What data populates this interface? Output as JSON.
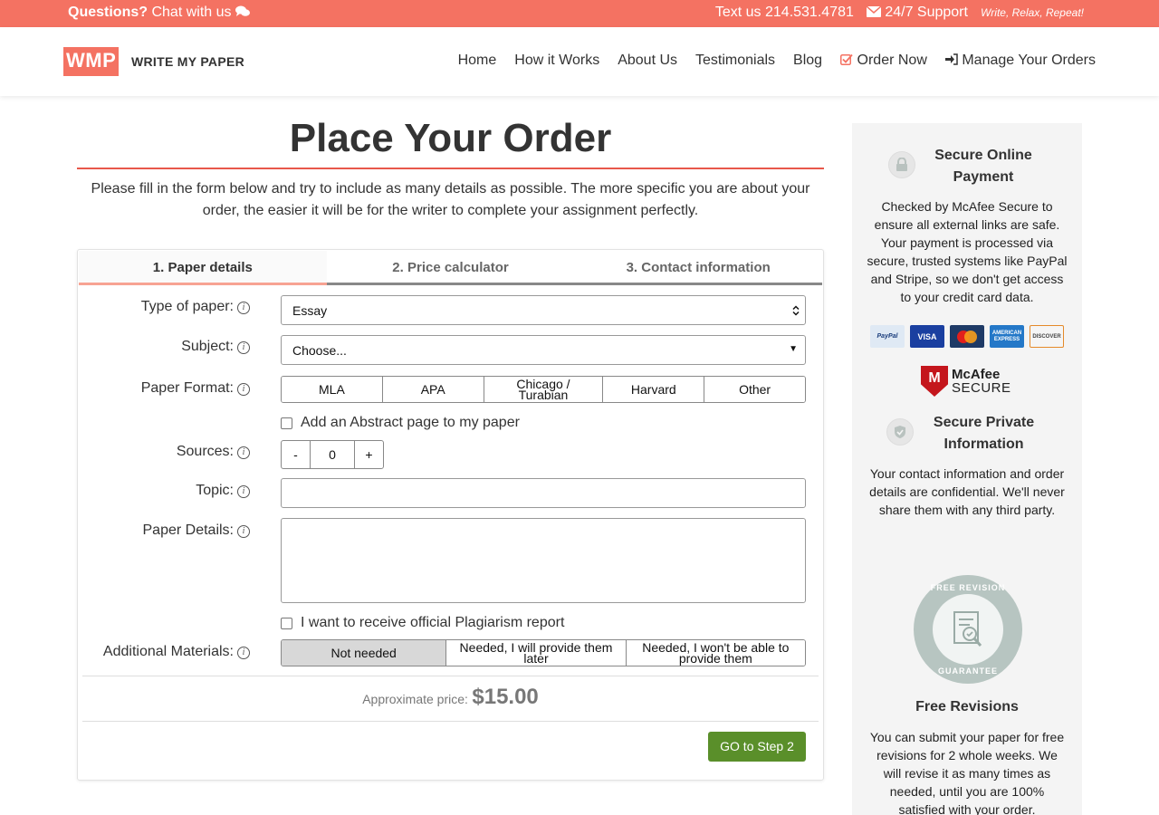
{
  "topbar": {
    "questions": "Questions?",
    "chat": "Chat with us",
    "text_us": "Text us 214.531.4781",
    "support": "24/7 Support",
    "tagline": "Write, Relax, Repeat!"
  },
  "brand": {
    "logo": "WMP",
    "name": "WRITE MY PAPER"
  },
  "nav": {
    "home": "Home",
    "how": "How it Works",
    "about": "About Us",
    "testimonials": "Testimonials",
    "blog": "Blog",
    "order": "Order Now",
    "manage": "Manage Your Orders"
  },
  "page": {
    "title": "Place Your Order",
    "intro": "Please fill in the form below and try to include as many details as possible. The more specific you are about your order, the easier it will be for the writer to complete your assignment perfectly."
  },
  "tabs": [
    "1. Paper details",
    "2. Price calculator",
    "3. Contact information"
  ],
  "form": {
    "type_label": "Type of paper:",
    "type_value": "Essay",
    "subject_label": "Subject:",
    "subject_value": "Choose...",
    "format_label": "Paper Format:",
    "formats": [
      "MLA",
      "APA",
      "Chicago / Turabian",
      "Harvard",
      "Other"
    ],
    "abstract_label": "Add an Abstract page to my paper",
    "sources_label": "Sources:",
    "sources_minus": "-",
    "sources_value": "0",
    "sources_plus": "+",
    "topic_label": "Topic:",
    "topic_value": "",
    "details_label": "Paper Details:",
    "details_value": "",
    "plagiarism_label": "I want to receive official Plagiarism report",
    "materials_label": "Additional Materials:",
    "materials": [
      "Not needed",
      "Needed, I will provide them later",
      "Needed, I won't be able to provide them"
    ],
    "price_label": "Approximate price:",
    "price_value": "$15.00",
    "go_button": "GO to Step 2"
  },
  "sidebar": {
    "secure_payment_title": "Secure Online Payment",
    "secure_payment_text": "Checked by McAfee Secure to ensure all external links are safe. Your payment is processed via secure, trusted systems like PayPal and Stripe, so we don't get access to your credit card data.",
    "cards": [
      "PayPal",
      "VISA",
      "MasterCard",
      "AMERICAN EXPRESS",
      "DISCOVER"
    ],
    "mcafee_brand": "McAfee",
    "mcafee_secure": "SECURE",
    "private_title": "Secure Private Information",
    "private_text": "Your contact information and order details are confidential. We'll never share them with any third party.",
    "seal_top": "FREE REVISION",
    "seal_bottom": "GUARANTEE",
    "revisions_title": "Free Revisions",
    "revisions_text": "You can submit your paper for free revisions for 2 whole weeks. We will revise it as many times as needed, until you are 100% satisfied with your order."
  },
  "colors": {
    "accent": "#f47262",
    "button_green": "#5a8f2a"
  }
}
